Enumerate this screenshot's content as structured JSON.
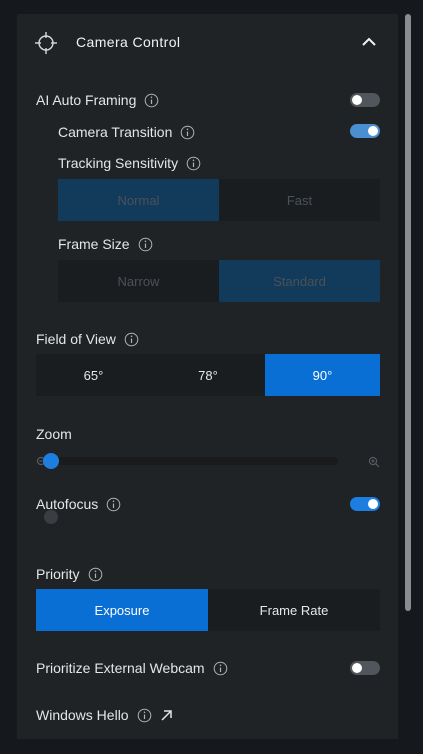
{
  "header": {
    "title": "Camera Control",
    "icon": "crosshair-icon",
    "collapse_icon": "chevron-up-icon"
  },
  "ai_auto_framing": {
    "label": "AI Auto Framing",
    "enabled": false
  },
  "camera_transition": {
    "label": "Camera Transition",
    "enabled": true
  },
  "tracking_sensitivity": {
    "label": "Tracking Sensitivity",
    "options": [
      "Normal",
      "Fast"
    ],
    "selected": "Normal"
  },
  "frame_size": {
    "label": "Frame Size",
    "options": [
      "Narrow",
      "Standard"
    ],
    "selected": "Standard"
  },
  "field_of_view": {
    "label": "Field of View",
    "options": [
      "65°",
      "78°",
      "90°"
    ],
    "selected": "90°"
  },
  "zoom": {
    "label": "Zoom",
    "level": 0,
    "min_icon": "zoom-out-icon",
    "max_icon": "zoom-in-icon"
  },
  "autofocus": {
    "label": "Autofocus",
    "enabled": true
  },
  "priority": {
    "label": "Priority",
    "options": [
      "Exposure",
      "Frame Rate"
    ],
    "selected": "Exposure"
  },
  "prioritize_external_webcam": {
    "label": "Prioritize External Webcam",
    "enabled": false
  },
  "windows_hello": {
    "label": "Windows Hello",
    "link_icon": "external-link-icon"
  },
  "colors": {
    "accent": "#0a6fd4",
    "panel": "#1f2326",
    "background": "#15191d"
  }
}
